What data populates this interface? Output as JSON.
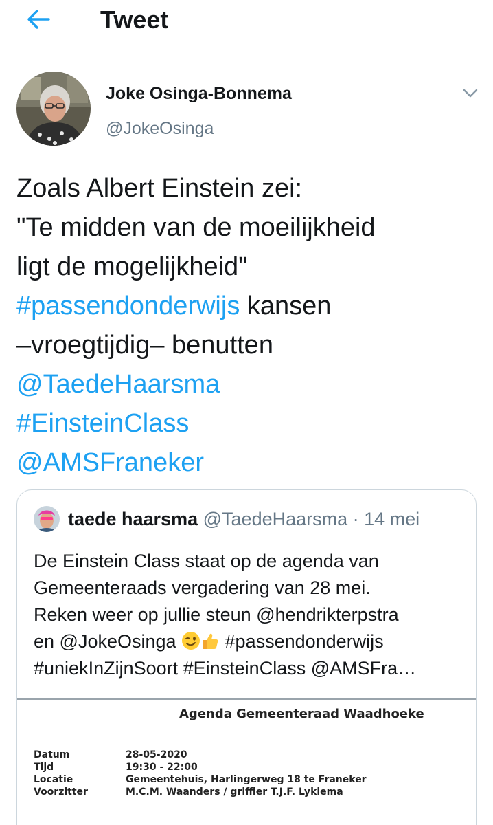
{
  "header": {
    "title": "Tweet",
    "back_icon": "arrow-left-icon"
  },
  "colors": {
    "accent": "#1da1f2",
    "text": "#14171a",
    "muted": "#657786",
    "border": "#ccd6dd"
  },
  "tweet": {
    "author_name": "Joke Osinga-Bonnema",
    "author_handle": "@JokeOsinga",
    "text": {
      "line1": "Zoals Albert Einstein zei:",
      "line2": "\"Te midden van de moeilijkheid",
      "line3": "ligt de mogelijkheid\"",
      "line4_link": "#passendonderwijs",
      "line4_rest": " kansen",
      "line5": "–vroegtijdig– benutten",
      "mention1": "@TaedeHaarsma",
      "hashtag2": "#EinsteinClass",
      "mention2": "@AMSFraneker"
    }
  },
  "quoted_tweet": {
    "author_name": "taede haarsma",
    "author_handle": "@TaedeHaarsma",
    "separator": " · ",
    "date": "14 mei",
    "text": {
      "line1": "De Einstein Class staat op de agenda van",
      "line2": "Gemeenteraads vergadering van 28 mei.",
      "line3": "Reken weer op jullie steun @hendrikterpstra",
      "line4_pre": "en @JokeOsinga ",
      "line4_post": " #passendonderwijs",
      "line5": "#uniekInZijnSoort #EinsteinClass @AMSFra…"
    },
    "emojis": [
      "winking-face-emoji",
      "thumbs-up-emoji"
    ],
    "document": {
      "title": "Agenda Gemeenteraad Waadhoeke",
      "rows": [
        {
          "label": "Datum",
          "value": "28-05-2020"
        },
        {
          "label": "Tijd",
          "value": "19:30 - 22:00"
        },
        {
          "label": "Locatie",
          "value": "Gemeentehuis, Harlingerweg 18 te Franeker"
        },
        {
          "label": "Voorzitter",
          "value": "M.C.M. Waanders / griffier T.J.F. Lyklema"
        }
      ]
    }
  }
}
